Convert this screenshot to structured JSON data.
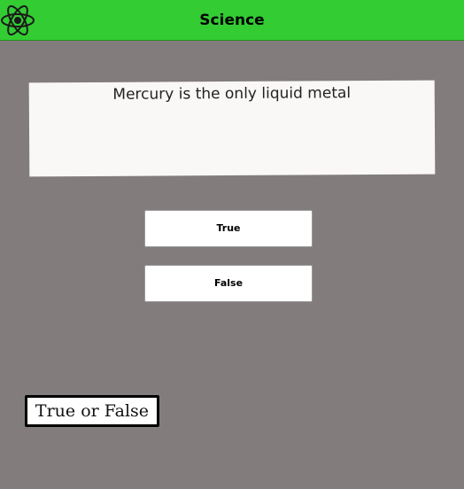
{
  "header": {
    "title": "Science",
    "icon": "atom-icon",
    "background_color": "#33cc33"
  },
  "question": {
    "text": "Mercury is the only liquid metal"
  },
  "answers": {
    "true_label": "True",
    "false_label": "False"
  },
  "mode": {
    "label": "True or False"
  },
  "colors": {
    "page_background": "#827d7c",
    "card_background": "#faf8f6"
  }
}
